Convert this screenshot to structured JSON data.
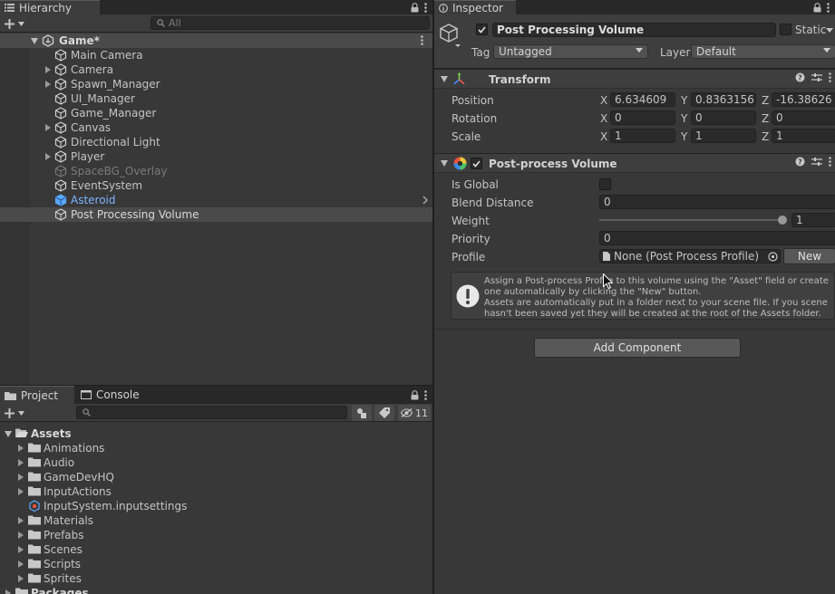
{
  "hierarchy": {
    "tab_label": "Hierarchy",
    "search_placeholder": "All",
    "scene_name": "Game*",
    "items": [
      {
        "label": "Main Camera",
        "depth": 1,
        "expandable": false,
        "style": "normal"
      },
      {
        "label": "Camera",
        "depth": 1,
        "expandable": true,
        "style": "normal"
      },
      {
        "label": "Spawn_Manager",
        "depth": 1,
        "expandable": true,
        "style": "normal"
      },
      {
        "label": "UI_Manager",
        "depth": 1,
        "expandable": false,
        "style": "normal"
      },
      {
        "label": "Game_Manager",
        "depth": 1,
        "expandable": false,
        "style": "normal"
      },
      {
        "label": "Canvas",
        "depth": 1,
        "expandable": true,
        "style": "normal"
      },
      {
        "label": "Directional Light",
        "depth": 1,
        "expandable": false,
        "style": "normal"
      },
      {
        "label": "Player",
        "depth": 1,
        "expandable": true,
        "style": "normal"
      },
      {
        "label": "SpaceBG_Overlay",
        "depth": 1,
        "expandable": false,
        "style": "disabled"
      },
      {
        "label": "EventSystem",
        "depth": 1,
        "expandable": false,
        "style": "normal"
      },
      {
        "label": "Asteroid",
        "depth": 1,
        "expandable": false,
        "style": "prefab"
      },
      {
        "label": "Post Processing Volume",
        "depth": 1,
        "expandable": false,
        "style": "selected"
      }
    ]
  },
  "project": {
    "tabs": [
      "Project",
      "Console"
    ],
    "hidden_count": "11",
    "items": [
      {
        "label": "Assets",
        "depth": 0,
        "kind": "folder-open",
        "expandable": true
      },
      {
        "label": "Animations",
        "depth": 1,
        "kind": "folder",
        "expandable": true
      },
      {
        "label": "Audio",
        "depth": 1,
        "kind": "folder",
        "expandable": true
      },
      {
        "label": "GameDevHQ",
        "depth": 1,
        "kind": "folder",
        "expandable": true
      },
      {
        "label": "InputActions",
        "depth": 1,
        "kind": "folder",
        "expandable": true
      },
      {
        "label": "InputSystem.inputsettings",
        "depth": 1,
        "kind": "asset",
        "expandable": false
      },
      {
        "label": "Materials",
        "depth": 1,
        "kind": "folder",
        "expandable": true
      },
      {
        "label": "Prefabs",
        "depth": 1,
        "kind": "folder",
        "expandable": true
      },
      {
        "label": "Scenes",
        "depth": 1,
        "kind": "folder",
        "expandable": true
      },
      {
        "label": "Scripts",
        "depth": 1,
        "kind": "folder",
        "expandable": true
      },
      {
        "label": "Sprites",
        "depth": 1,
        "kind": "folder",
        "expandable": true
      },
      {
        "label": "Packages",
        "depth": 0,
        "kind": "folder",
        "expandable": true
      }
    ]
  },
  "inspector": {
    "tab_label": "Inspector",
    "object_name": "Post Processing Volume",
    "static_label": "Static",
    "tag_label": "Tag",
    "tag_value": "Untagged",
    "layer_label": "Layer",
    "layer_value": "Default",
    "transform": {
      "title": "Transform",
      "position_label": "Position",
      "rotation_label": "Rotation",
      "scale_label": "Scale",
      "axis_x": "X",
      "axis_y": "Y",
      "axis_z": "Z",
      "position": {
        "x": "6.634609",
        "y": "0.8363156",
        "z": "-16.38626"
      },
      "rotation": {
        "x": "0",
        "y": "0",
        "z": "0"
      },
      "scale": {
        "x": "1",
        "y": "1",
        "z": "1"
      }
    },
    "post_process": {
      "title": "Post-process Volume",
      "is_global_label": "Is Global",
      "blend_distance_label": "Blend Distance",
      "blend_distance_value": "0",
      "weight_label": "Weight",
      "weight_value": "1",
      "priority_label": "Priority",
      "priority_value": "0",
      "profile_label": "Profile",
      "profile_value": "None (Post Process Profile)",
      "new_button": "New",
      "help_line1": "Assign a Post-process Profile to this volume using the \"Asset\" field or create one automatically by clicking the \"New\" button.",
      "help_line2": "Assets are automatically put in a folder next to your scene file. If you scene hasn't been saved yet they will be created at the root of the Assets folder."
    },
    "add_component": "Add Component"
  },
  "colors": {
    "panel": "#383838",
    "selection": "#4a4a4a",
    "prefab_text": "#7ab4ff",
    "disabled_text": "#7a7a7a"
  }
}
